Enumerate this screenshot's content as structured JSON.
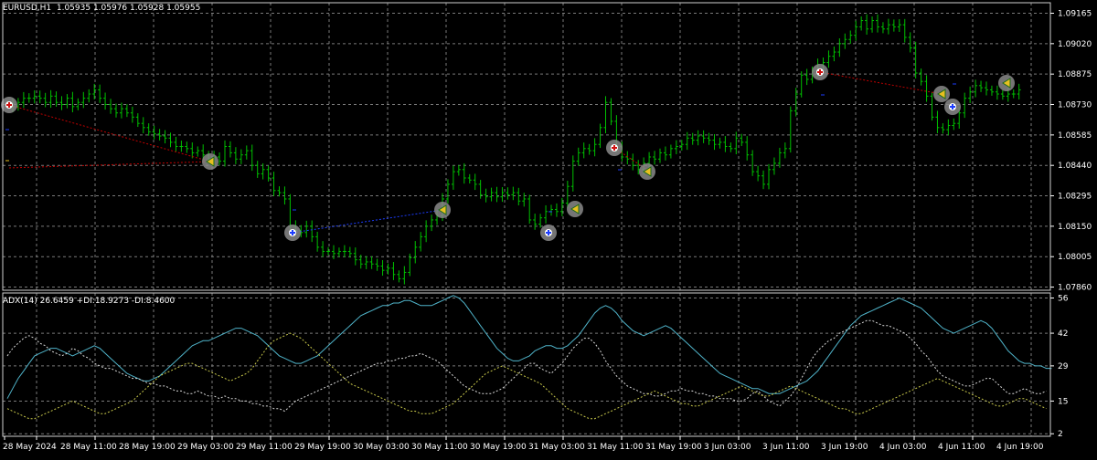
{
  "main": {
    "header": {
      "symbol": "EURUSD,H1",
      "ohlc": "1.05935 1.05976 1.05928 1.05955"
    },
    "price_labels": [
      "1.09165",
      "1.09020",
      "1.08875",
      "1.08730",
      "1.08585",
      "1.08440",
      "1.08295",
      "1.08150",
      "1.08005",
      "1.07860"
    ],
    "price_range": [
      1.07845,
      1.09215
    ]
  },
  "indicator": {
    "header": "ADX(14) 26.6459 +DI:18.9273 -DI:8.4600",
    "levels": [
      "56",
      "42",
      "29",
      "15",
      "2"
    ],
    "range": [
      1,
      58
    ]
  },
  "time_labels": [
    "28 May 2024",
    "28 May 11:00",
    "28 May 19:00",
    "29 May 03:00",
    "29 May 11:00",
    "29 May 19:00",
    "30 May 03:00",
    "30 May 11:00",
    "30 May 19:00",
    "31 May 03:00",
    "31 May 11:00",
    "31 May 19:00",
    "3 Jun 03:00",
    "3 Jun 11:00",
    "3 Jun 19:00",
    "4 Jun 03:00",
    "4 Jun 11:00",
    "4 Jun 19:00"
  ],
  "colors": {
    "background": "#000000",
    "grid": "#7a7a7a",
    "bars": "#00c000",
    "axis_text": "#ffffff",
    "adx_line": "#4fb3c9",
    "plus_di": "#d8d8d8",
    "minus_di": "#c8c84a",
    "zigzag_red": "#c00000",
    "zigzag_blue": "#1c3cff"
  },
  "chart_data": [
    {
      "type": "candlestick",
      "title": "EURUSD,H1",
      "series": [
        {
          "name": "EURUSD",
          "close": [
            1.0873,
            1.0872,
            1.0874,
            1.0876,
            1.0876,
            1.0877,
            1.0876,
            1.0874,
            1.0877,
            1.0874,
            1.0873,
            1.0876,
            1.0872,
            1.0874,
            1.0876,
            1.0878,
            1.088,
            1.0876,
            1.0873,
            1.0871,
            1.0869,
            1.0871,
            1.0869,
            1.0867,
            1.0864,
            1.0862,
            1.086,
            1.0859,
            1.0858,
            1.0857,
            1.0855,
            1.0853,
            1.0853,
            1.0852,
            1.085,
            1.0851,
            1.0849,
            1.0847,
            1.0848,
            1.0846,
            1.0853,
            1.085,
            1.0847,
            1.0849,
            1.0851,
            1.0844,
            1.084,
            1.0842,
            1.0838,
            1.0832,
            1.0831,
            1.0828,
            1.0815,
            1.0813,
            1.0812,
            1.0815,
            1.081,
            1.0805,
            1.0803,
            1.0803,
            1.0802,
            1.0803,
            1.0803,
            1.0802,
            1.0799,
            1.0797,
            1.0798,
            1.0797,
            1.0796,
            1.0794,
            1.0795,
            1.0792,
            1.079,
            1.0793,
            1.08,
            1.0805,
            1.081,
            1.0815,
            1.0818,
            1.082,
            1.0828,
            1.0835,
            1.0841,
            1.0842,
            1.0838,
            1.0837,
            1.0835,
            1.083,
            1.0829,
            1.0831,
            1.0829,
            1.0831,
            1.083,
            1.0831,
            1.0827,
            1.0828,
            1.0818,
            1.0816,
            1.0819,
            1.0822,
            1.0823,
            1.0822,
            1.0826,
            1.0834,
            1.0846,
            1.085,
            1.0852,
            1.0851,
            1.0854,
            1.0862,
            1.0874,
            1.0865,
            1.0853,
            1.0848,
            1.0847,
            1.0844,
            1.0842,
            1.0845,
            1.0848,
            1.0847,
            1.085,
            1.0849,
            1.0852,
            1.0853,
            1.0854,
            1.0857,
            1.0856,
            1.0858,
            1.0857,
            1.0856,
            1.0854,
            1.0855,
            1.0853,
            1.0852,
            1.0857,
            1.0855,
            1.0849,
            1.0841,
            1.0839,
            1.0835,
            1.0842,
            1.0845,
            1.085,
            1.0852,
            1.087,
            1.0878,
            1.0887,
            1.0885,
            1.0889,
            1.0892,
            1.0893,
            1.0896,
            1.0898,
            1.0902,
            1.0904,
            1.0906,
            1.091,
            1.0913,
            1.0909,
            1.0913,
            1.091,
            1.0909,
            1.0911,
            1.091,
            1.0911,
            1.0905,
            1.09,
            1.0888,
            1.0884,
            1.0877,
            1.0867,
            1.0862,
            1.0861,
            1.0863,
            1.0864,
            1.0869,
            1.0876,
            1.0879,
            1.0882,
            1.0881,
            1.088,
            1.0879,
            1.0878,
            1.0877,
            1.0878,
            1.0878,
            1.088
          ]
        }
      ]
    },
    {
      "type": "line",
      "title": "ADX(14) 26.6459 +DI:18.9273 -DI:8.4600",
      "ylim": [
        1,
        58
      ],
      "series": [
        {
          "name": "ADX",
          "values": [
            16,
            20,
            24,
            27,
            30,
            33,
            34,
            35,
            36,
            36,
            35,
            34,
            33,
            34,
            35,
            36,
            37,
            36,
            34,
            32,
            30,
            28,
            26,
            25,
            24,
            23,
            23,
            24,
            25,
            27,
            29,
            31,
            33,
            35,
            37,
            38,
            39,
            39,
            40,
            41,
            42,
            43,
            44,
            44,
            43,
            42,
            41,
            39,
            37,
            35,
            33,
            32,
            31,
            30,
            30,
            31,
            32,
            33,
            35,
            37,
            39,
            41,
            43,
            45,
            47,
            49,
            50,
            51,
            52,
            53,
            53,
            54,
            54,
            55,
            55,
            54,
            53,
            53,
            53,
            54,
            55,
            56,
            57,
            56,
            54,
            51,
            48,
            45,
            42,
            39,
            36,
            34,
            32,
            31,
            31,
            32,
            33,
            35,
            36,
            37,
            37,
            36,
            36,
            37,
            39,
            41,
            44,
            47,
            50,
            52,
            53,
            52,
            50,
            47,
            45,
            43,
            42,
            41,
            42,
            43,
            44,
            45,
            44,
            42,
            40,
            38,
            36,
            34,
            32,
            30,
            28,
            26,
            25,
            24,
            23,
            22,
            21,
            20,
            20,
            19,
            18,
            18,
            18,
            19,
            20,
            21,
            22,
            23,
            25,
            27,
            30,
            33,
            36,
            39,
            42,
            45,
            47,
            49,
            50,
            51,
            52,
            53,
            54,
            55,
            56,
            55,
            54,
            53,
            52,
            50,
            48,
            46,
            44,
            43,
            42,
            43,
            44,
            45,
            46,
            47,
            46,
            44,
            41,
            38,
            35,
            33,
            31,
            30,
            30,
            29,
            29,
            28,
            28
          ]
        },
        {
          "name": "+DI",
          "values": [
            33,
            36,
            38,
            40,
            41,
            40,
            38,
            37,
            35,
            34,
            33,
            34,
            36,
            35,
            33,
            32,
            30,
            29,
            28,
            28,
            27,
            26,
            25,
            24,
            24,
            23,
            22,
            22,
            21,
            21,
            20,
            19,
            19,
            18,
            18,
            19,
            18,
            17,
            17,
            16,
            17,
            16,
            16,
            15,
            15,
            14,
            14,
            13,
            13,
            12,
            12,
            11,
            13,
            15,
            16,
            17,
            18,
            19,
            20,
            21,
            22,
            23,
            24,
            25,
            26,
            27,
            28,
            29,
            30,
            30,
            31,
            31,
            32,
            32,
            33,
            33,
            34,
            33,
            32,
            31,
            29,
            27,
            25,
            23,
            21,
            20,
            19,
            18,
            18,
            18,
            19,
            20,
            22,
            24,
            26,
            28,
            30,
            30,
            28,
            27,
            26,
            28,
            30,
            33,
            36,
            38,
            40,
            40,
            38,
            35,
            31,
            28,
            25,
            23,
            21,
            20,
            19,
            18,
            18,
            17,
            17,
            18,
            19,
            19,
            20,
            19,
            19,
            18,
            18,
            17,
            17,
            16,
            16,
            16,
            15,
            15,
            16,
            18,
            19,
            17,
            15,
            14,
            13,
            15,
            17,
            20,
            24,
            28,
            32,
            35,
            37,
            39,
            40,
            42,
            43,
            44,
            45,
            46,
            47,
            47,
            46,
            45,
            45,
            44,
            43,
            42,
            40,
            38,
            35,
            33,
            30,
            27,
            25,
            24,
            23,
            22,
            21,
            21,
            22,
            23,
            24,
            24,
            22,
            20,
            18,
            18,
            19,
            20,
            19,
            18,
            18,
            19
          ]
        },
        {
          "name": "-DI",
          "values": [
            12,
            11,
            10,
            9,
            8,
            8,
            9,
            10,
            11,
            12,
            13,
            14,
            15,
            14,
            13,
            12,
            11,
            10,
            10,
            11,
            12,
            13,
            14,
            15,
            17,
            19,
            21,
            23,
            25,
            26,
            27,
            28,
            29,
            30,
            30,
            29,
            28,
            27,
            26,
            25,
            24,
            23,
            24,
            25,
            26,
            28,
            31,
            34,
            37,
            39,
            40,
            41,
            42,
            41,
            40,
            38,
            36,
            34,
            32,
            30,
            28,
            26,
            24,
            22,
            21,
            20,
            19,
            18,
            17,
            16,
            15,
            14,
            13,
            12,
            11,
            11,
            10,
            10,
            10,
            11,
            12,
            13,
            14,
            16,
            18,
            20,
            22,
            24,
            26,
            27,
            28,
            29,
            28,
            27,
            26,
            25,
            24,
            23,
            22,
            20,
            18,
            16,
            14,
            12,
            11,
            10,
            9,
            8,
            8,
            9,
            10,
            11,
            12,
            13,
            14,
            15,
            16,
            17,
            18,
            19,
            18,
            17,
            16,
            15,
            14,
            14,
            13,
            13,
            14,
            15,
            16,
            17,
            18,
            19,
            20,
            21,
            20,
            19,
            18,
            17,
            17,
            18,
            19,
            20,
            21,
            20,
            19,
            18,
            17,
            16,
            15,
            14,
            13,
            12,
            12,
            11,
            10,
            10,
            11,
            12,
            13,
            14,
            15,
            16,
            17,
            18,
            19,
            20,
            21,
            22,
            23,
            24,
            23,
            22,
            21,
            20,
            19,
            18,
            17,
            16,
            15,
            14,
            13,
            13,
            14,
            15,
            16,
            16,
            15,
            14,
            13,
            12
          ]
        }
      ]
    }
  ]
}
